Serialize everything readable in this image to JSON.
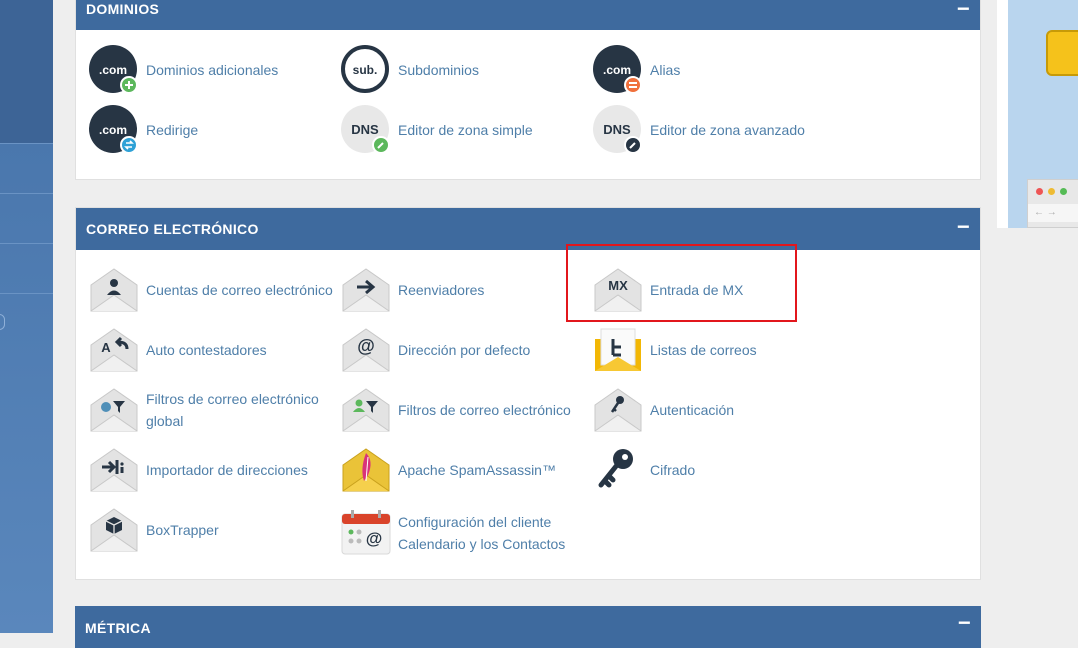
{
  "sections": {
    "dominios": {
      "title": "DOMINIOS",
      "collapse": "−",
      "items": {
        "addon": "Dominios adicionales",
        "sub": "Subdominios",
        "alias": "Alias",
        "redirect": "Redirige",
        "zone_simple": "Editor de zona simple",
        "zone_adv": "Editor de zona avanzado"
      },
      "icons": {
        "com": ".com",
        "sub": "sub.",
        "dns": "DNS"
      }
    },
    "correo": {
      "title": "CORREO ELECTRÓNICO",
      "collapse": "−",
      "items": {
        "accounts": "Cuentas de correo electrónico",
        "forwarders": "Reenviadores",
        "mx": "Entrada de MX",
        "autoresp": "Auto contestadores",
        "default_addr": "Dirección por defecto",
        "lists": "Listas de correos",
        "filters_global_1": "Filtros de correo electrónico",
        "filters_global_2": "global",
        "filters": "Filtros de correo electrónico",
        "auth": "Autenticación",
        "importer": "Importador de direcciones",
        "spamassassin": "Apache SpamAssassin™",
        "encryption": "Cifrado",
        "boxtrapper": "BoxTrapper",
        "calendar_1": "Configuración del cliente",
        "calendar_2": "Calendario y los Contactos"
      },
      "icons": {
        "mx": "MX",
        "at": "@",
        "autoresp": "A"
      }
    },
    "metrica": {
      "title": "MÉTRICA",
      "collapse": "−"
    }
  },
  "colors": {
    "header": "#3e6a9e",
    "link": "#4f7fa9",
    "highlight": "#e2161c",
    "sidebar": "#3d6496"
  }
}
